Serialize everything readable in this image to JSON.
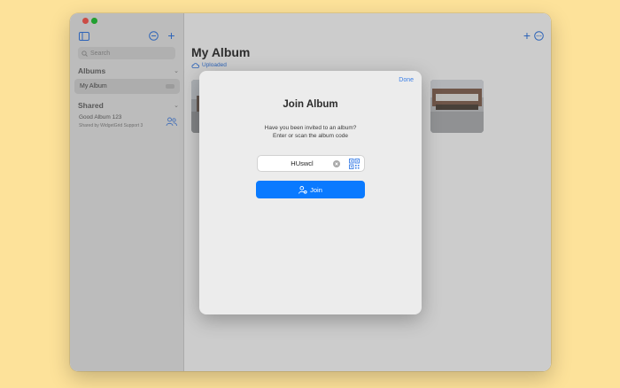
{
  "sidebar": {
    "search_placeholder": "Search",
    "albums_header": "Albums",
    "album_item": "My Album",
    "shared_header": "Shared",
    "shared_item_title": "Good Album 123",
    "shared_item_subtitle": "Shared by WidgetGrid Support 3"
  },
  "main": {
    "title": "My Album",
    "status": "Uploaded"
  },
  "dialog": {
    "done_label": "Done",
    "title": "Join Album",
    "desc_line1": "Have you been invited to an album?",
    "desc_line2": "Enter or scan the album code",
    "code_value": "HUswcl",
    "join_label": "Join"
  },
  "colors": {
    "accent": "#0a7aff",
    "background": "#fde29a"
  },
  "icons": [
    "sidebar-toggle-icon",
    "filter-icon",
    "add-icon",
    "search-icon",
    "chevron-down-icon",
    "people-icon",
    "cloud-icon",
    "more-icon",
    "clear-icon",
    "qr-code-icon",
    "person-add-icon"
  ]
}
